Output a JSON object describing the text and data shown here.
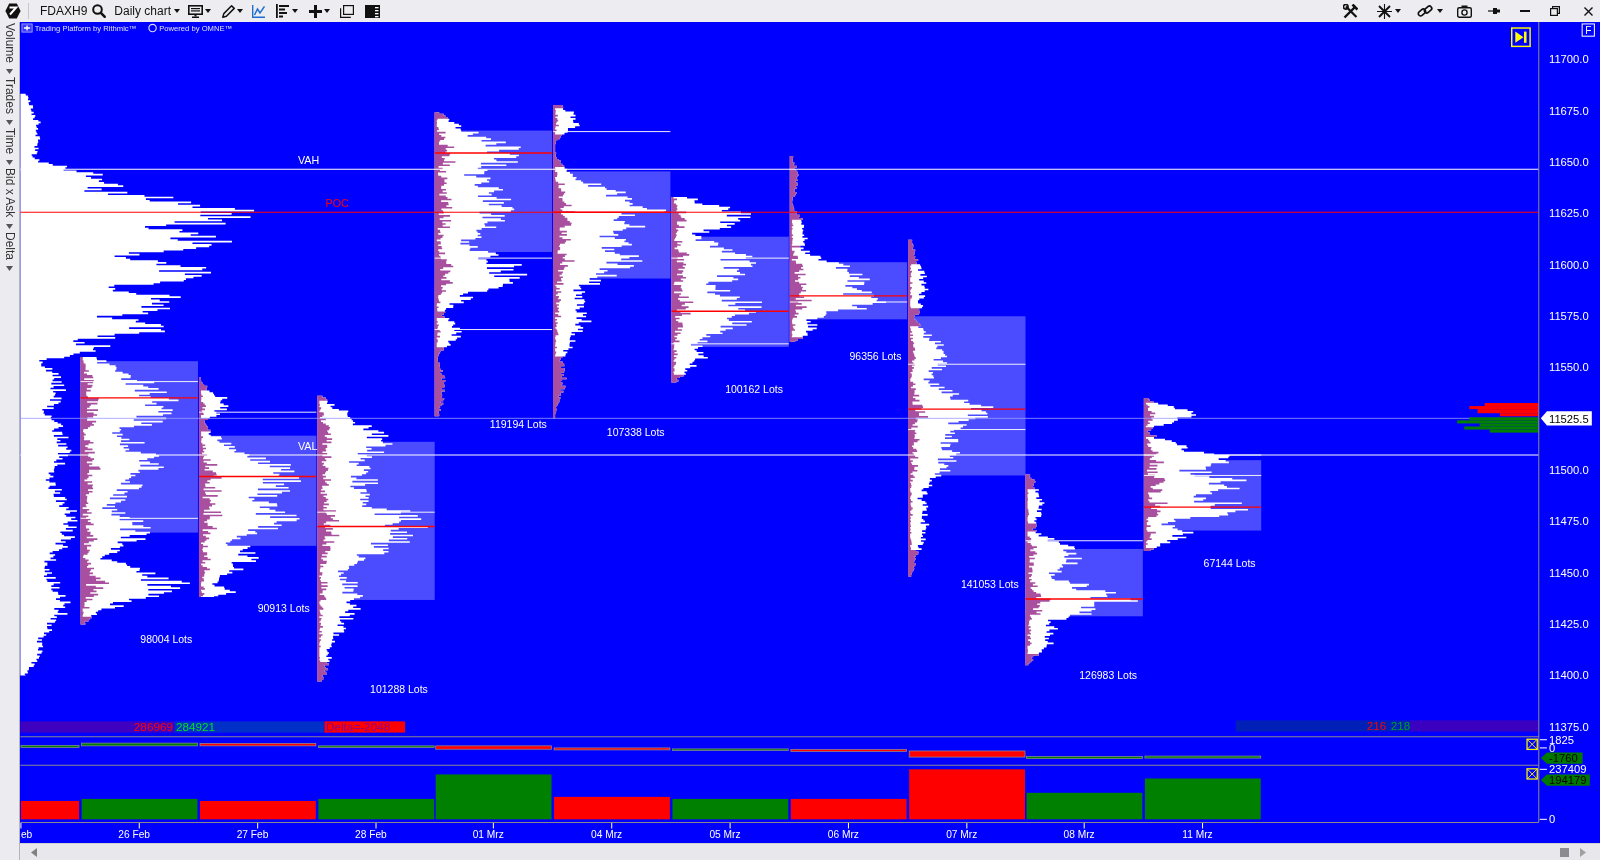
{
  "toolbar": {
    "symbol": "FDAXH9",
    "chart_type": "Daily chart"
  },
  "side_tabs": [
    {
      "label": "Volume"
    },
    {
      "label": "Trades"
    },
    {
      "label": "Time"
    },
    {
      "label": "Bid x Ask"
    },
    {
      "label": "Delta"
    }
  ],
  "price_pane": {
    "branding": [
      "Trading Platform by Rithmic™",
      "Powered by OMNE™"
    ],
    "axis_button": "F",
    "level_labels": [
      {
        "label": "VAH",
        "kind": "value_area"
      },
      {
        "label": "POC",
        "kind": "poc"
      },
      {
        "label": "VAL",
        "kind": "value_area"
      }
    ],
    "sessions": [
      {
        "lots": "98004 Lots"
      },
      {
        "lots": "90913 Lots"
      },
      {
        "lots": "101288 Lots"
      },
      {
        "lots": "119194 Lots"
      },
      {
        "lots": "107338 Lots"
      },
      {
        "lots": "100162 Lots"
      },
      {
        "lots": "96356 Lots"
      },
      {
        "lots": "141053 Lots"
      },
      {
        "lots": "126983 Lots"
      },
      {
        "lots": "67144 Lots"
      }
    ],
    "price_ticks": [
      "11700.0",
      "11675.0",
      "11650.0",
      "11625.0",
      "11600.0",
      "11575.0",
      "11550.0",
      "11500.0",
      "11475.0",
      "11450.0",
      "11425.0",
      "11400.0",
      "11375.0"
    ],
    "last_price": "11525.5",
    "session_totals": {
      "sell": "286969",
      "buy": "284921",
      "delta": "Delta=-2048"
    },
    "live_totals": {
      "sell": "216",
      "buy": "218"
    }
  },
  "delta_pane": {
    "ticks": [
      "1825",
      "0"
    ],
    "current": "-1760"
  },
  "volume_pane": {
    "ticks": [
      "237409",
      "0"
    ],
    "current": "194179"
  },
  "date_axis": [
    "eb",
    "26 Feb",
    "27 Feb",
    "28 Feb",
    "01 Mrz",
    "04 Mrz",
    "05 Mrz",
    "06 Mrz",
    "07 Mrz",
    "08 Mrz",
    "11 Mrz"
  ]
}
